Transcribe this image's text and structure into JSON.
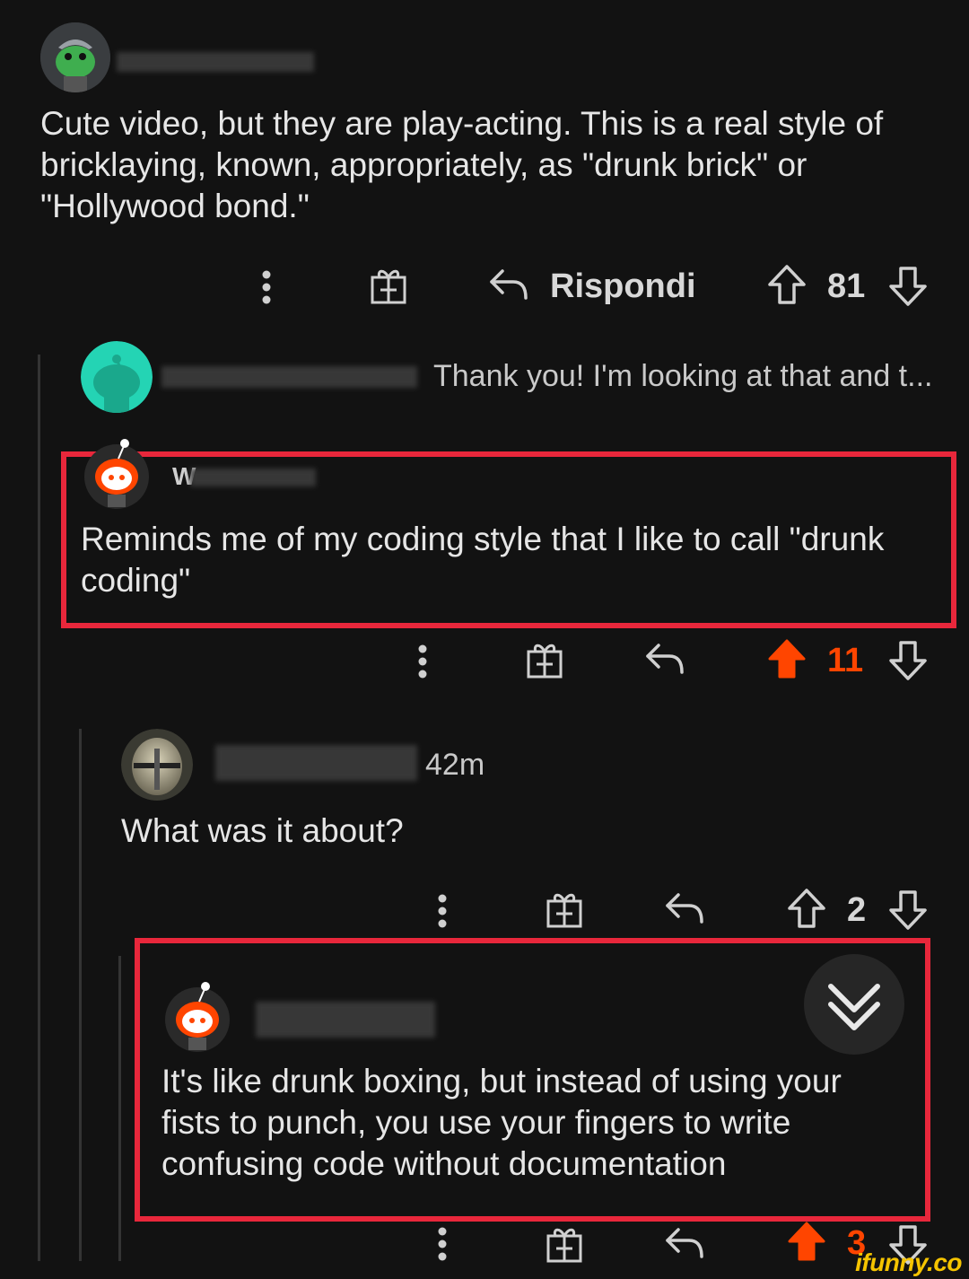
{
  "comments": [
    {
      "text": "Cute video, but they are play-acting.  This is a real style of bricklaying, known, appropriately, as \"drunk brick\" or \"Hollywood bond.\"",
      "reply_label": "Rispondi",
      "votes": "81",
      "upvoted": false
    },
    {
      "collapsed_preview": "Thank you! I'm looking at that and t...",
      "username_initial": "W"
    },
    {
      "text": "Reminds me of my coding style that I like to call \"drunk coding\"",
      "votes": "11",
      "upvoted": true
    },
    {
      "timestamp": "42m",
      "text": "What was it about?",
      "votes": "2",
      "upvoted": false
    },
    {
      "text": "It's like drunk boxing, but instead of using your fists to punch, you use your fingers to write confusing code without documentation",
      "votes": "3",
      "upvoted": true
    }
  ],
  "colors": {
    "background": "#121212",
    "upvote": "#ff4500",
    "highlight": "#e8273b"
  },
  "watermark": "ifunny.co"
}
